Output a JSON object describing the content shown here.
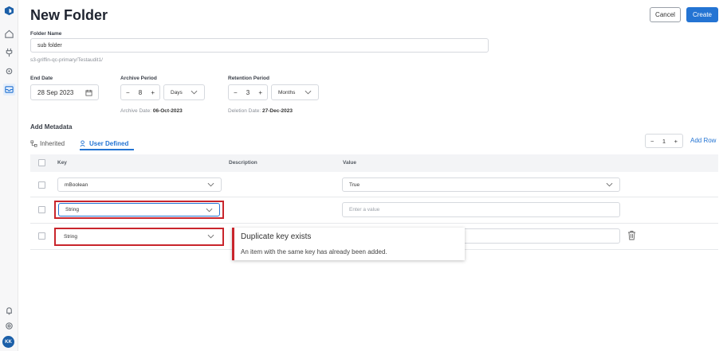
{
  "header": {
    "title": "New Folder",
    "cancel_label": "Cancel",
    "create_label": "Create"
  },
  "folder": {
    "label": "Folder Name",
    "value": "sub folder",
    "path": "s3-griffin-qc-primary/Testaudit1/"
  },
  "end_date": {
    "label": "End Date",
    "value": "28 Sep 2023"
  },
  "archive": {
    "label": "Archive Period",
    "value": "8",
    "unit": "Days",
    "note_prefix": "Archive Date:",
    "note_date": "06-Oct-2023"
  },
  "retention": {
    "label": "Retention Period",
    "value": "3",
    "unit": "Months",
    "note_prefix": "Deletion Date:",
    "note_date": "27-Dec-2023"
  },
  "metadata": {
    "heading": "Add Metadata",
    "tab_inherited": "Inherited",
    "tab_user_defined": "User Defined",
    "row_count": "1",
    "add_row_label": "Add Row",
    "columns": {
      "key": "Key",
      "description": "Description",
      "value": "Value"
    },
    "rows": [
      {
        "key": "mBoolean",
        "value": "True",
        "value_placeholder": ""
      },
      {
        "key": "String",
        "value": "",
        "value_placeholder": "Enter a value"
      },
      {
        "key": "String",
        "value": "",
        "value_placeholder": ""
      }
    ]
  },
  "error": {
    "title": "Duplicate key exists",
    "message": "An item with the same key has already been added."
  },
  "user": {
    "initials": "KK"
  },
  "colors": {
    "accent": "#2474d3",
    "error": "#c9252c"
  },
  "icons": [
    "logo-icon",
    "home-icon",
    "plug-icon",
    "settings-cog-icon",
    "inbox-icon",
    "bell-icon",
    "gear-icon",
    "calendar-icon",
    "chevron-down-icon",
    "trash-icon",
    "hierarchy-icon",
    "user-key-icon"
  ]
}
